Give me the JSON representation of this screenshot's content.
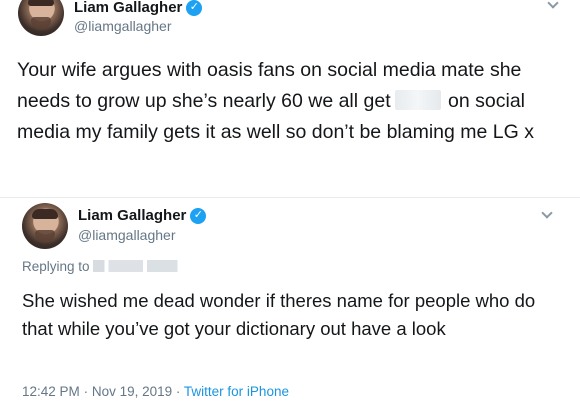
{
  "tweets": [
    {
      "author": {
        "display_name": "Liam Gallagher",
        "handle": "@liamgallagher",
        "verified_glyph": "✓",
        "avatar_icon": "avatar-photo"
      },
      "text_parts": [
        "Your wife argues with oasis fans on social media mate she needs to grow up she’s nearly 60 we all get",
        "on social media my family gets it as well so don’t be blaming me LG x"
      ]
    },
    {
      "author": {
        "display_name": "Liam Gallagher",
        "handle": "@liamgallagher",
        "verified_glyph": "✓",
        "avatar_icon": "avatar-photo"
      },
      "replying_to_prefix": "Replying to",
      "text": "She wished me dead wonder if theres name for people who do that while you’ve got your dictionary out have a look",
      "time": "12:42 PM",
      "separator": "·",
      "date": "Nov 19, 2019",
      "source": "Twitter for iPhone"
    }
  ],
  "colors": {
    "link": "#1b95e0",
    "verified": "#1da1f2",
    "secondary_text": "#657786",
    "primary_text": "#14171a"
  },
  "icons": [
    "verified-badge-icon",
    "chevron-down-icon",
    "avatar-photo"
  ]
}
